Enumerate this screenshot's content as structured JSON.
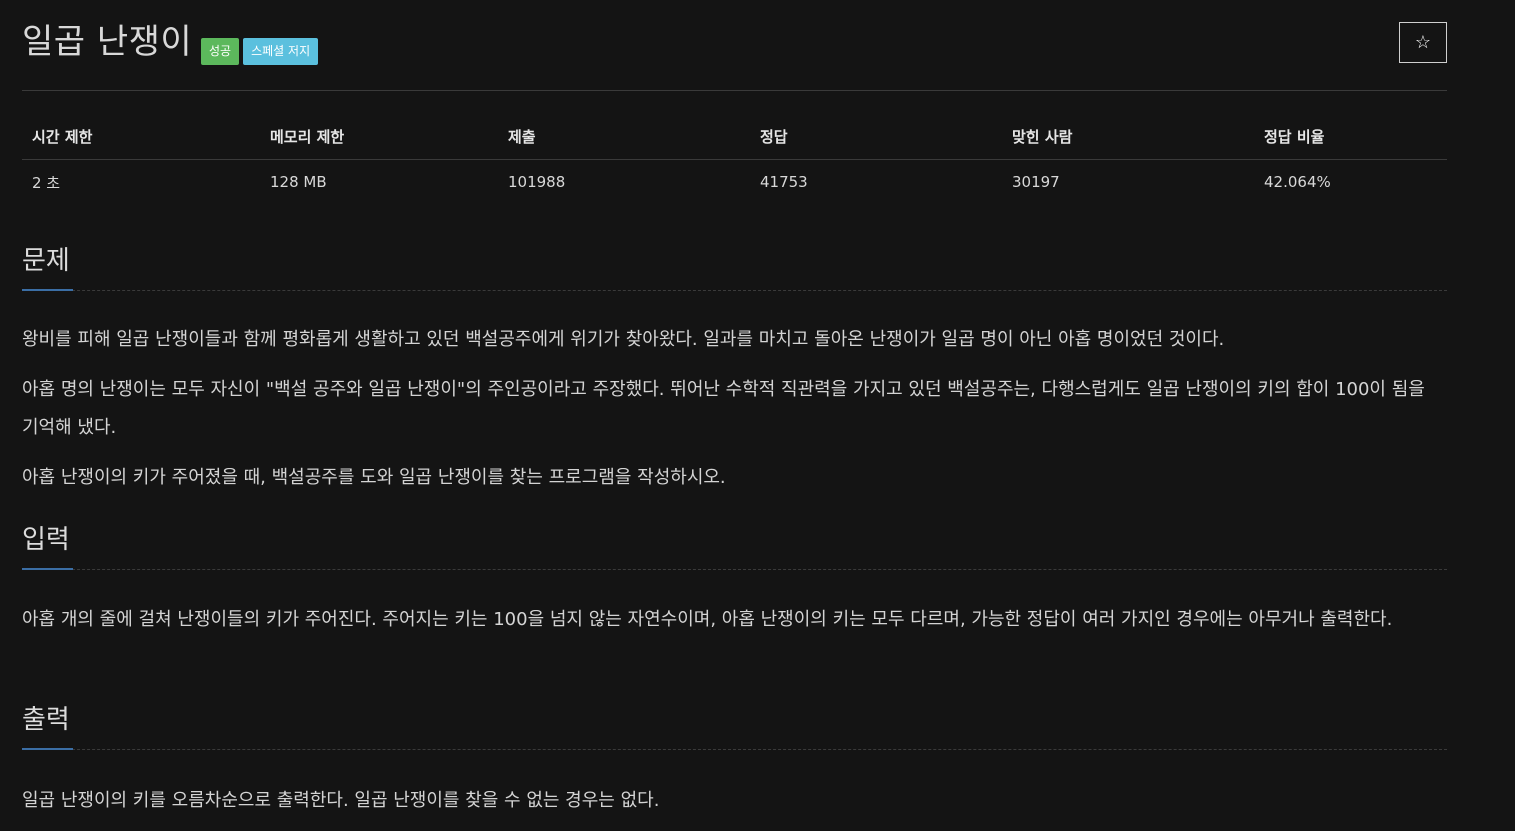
{
  "problem": {
    "title": "일곱 난쟁이",
    "badges": [
      {
        "label": "성공",
        "color": "#5cb85c"
      },
      {
        "label": "스페셜 저지",
        "color": "#5bc0de"
      }
    ],
    "star_icon": "☆"
  },
  "info_table": {
    "headers": [
      "시간 제한",
      "메모리 제한",
      "제출",
      "정답",
      "맞힌 사람",
      "정답 비율"
    ],
    "values": [
      "2 초",
      "128 MB",
      "101988",
      "41753",
      "30197",
      "42.064%"
    ]
  },
  "sections": {
    "description": {
      "title": "문제",
      "paragraphs": [
        "왕비를 피해 일곱 난쟁이들과 함께 평화롭게 생활하고 있던 백설공주에게 위기가 찾아왔다. 일과를 마치고 돌아온 난쟁이가 일곱 명이 아닌 아홉 명이었던 것이다.",
        "아홉 명의 난쟁이는 모두 자신이 \"백설 공주와 일곱 난쟁이\"의 주인공이라고 주장했다. 뛰어난 수학적 직관력을 가지고 있던 백설공주는, 다행스럽게도 일곱 난쟁이의 키의 합이 100이 됨을 기억해 냈다.",
        "아홉 난쟁이의 키가 주어졌을 때, 백설공주를 도와 일곱 난쟁이를 찾는 프로그램을 작성하시오."
      ]
    },
    "input": {
      "title": "입력",
      "paragraphs": [
        "아홉 개의 줄에 걸쳐 난쟁이들의 키가 주어진다. 주어지는 키는 100을 넘지 않는 자연수이며, 아홉 난쟁이의 키는 모두 다르며, 가능한 정답이 여러 가지인 경우에는 아무거나 출력한다."
      ]
    },
    "output": {
      "title": "출력",
      "paragraphs": [
        "일곱 난쟁이의 키를 오름차순으로 출력한다. 일곱 난쟁이를 찾을 수 없는 경우는 없다."
      ]
    }
  },
  "colors": {
    "background": "#141414",
    "accent_underline": "#3b6ea5",
    "badge_success": "#5cb85c",
    "badge_special_judge": "#5bc0de"
  }
}
